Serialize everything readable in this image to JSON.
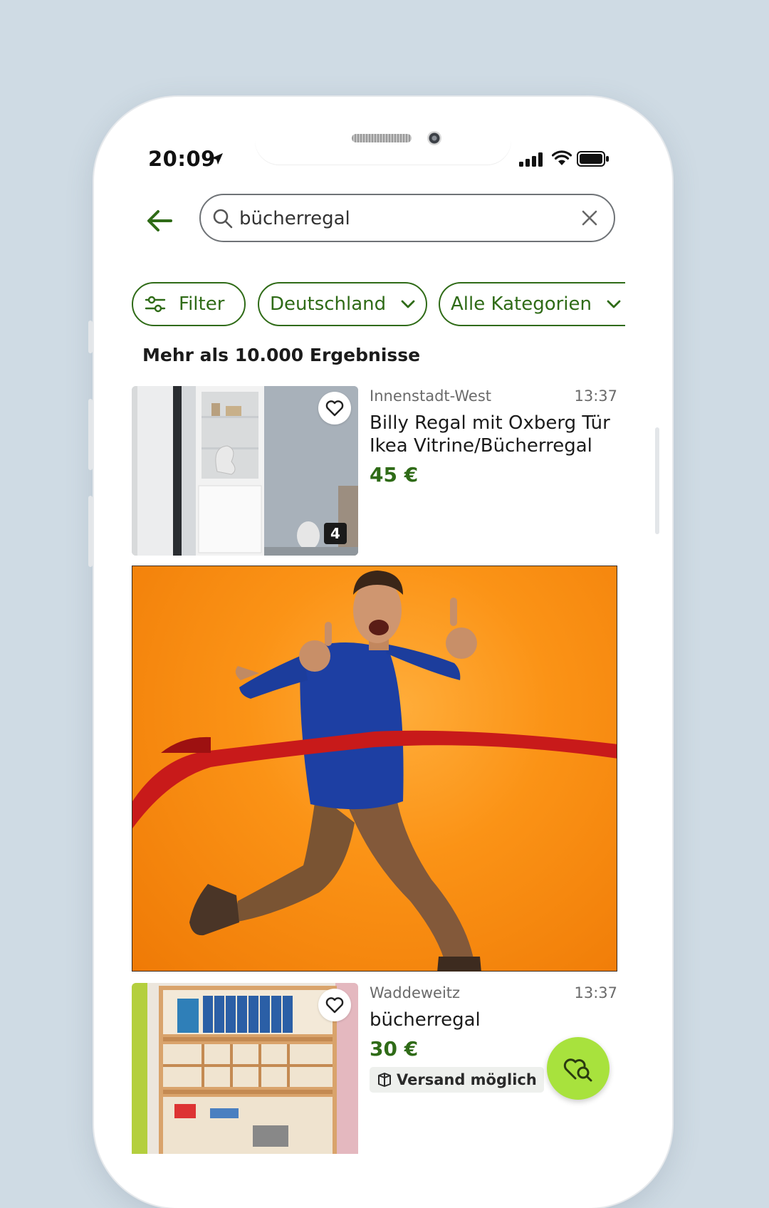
{
  "status_bar": {
    "time": "20:09"
  },
  "search": {
    "query": "bücherregal"
  },
  "chips": [
    {
      "label": "Filter"
    },
    {
      "label": "Deutschland"
    },
    {
      "label": "Alle Kategorien"
    }
  ],
  "results_count": "Mehr als 10.000 Ergebnisse",
  "listings": [
    {
      "location": "Innenstadt-West",
      "time": "13:37",
      "title_line1": "Billy Regal mit Oxberg Tür",
      "title_line2": "Ikea Vitrine/Bücherregal",
      "price": "45 €",
      "image_count": "4"
    },
    {
      "location": "Waddeweitz",
      "time": "13:37",
      "title": "bücherregal",
      "price": "30 €",
      "shipping": "Versand möglich"
    }
  ],
  "colors": {
    "brand_green": "#2f6b17",
    "fab_green": "#a8e23d",
    "background": "#cfdbe4"
  }
}
